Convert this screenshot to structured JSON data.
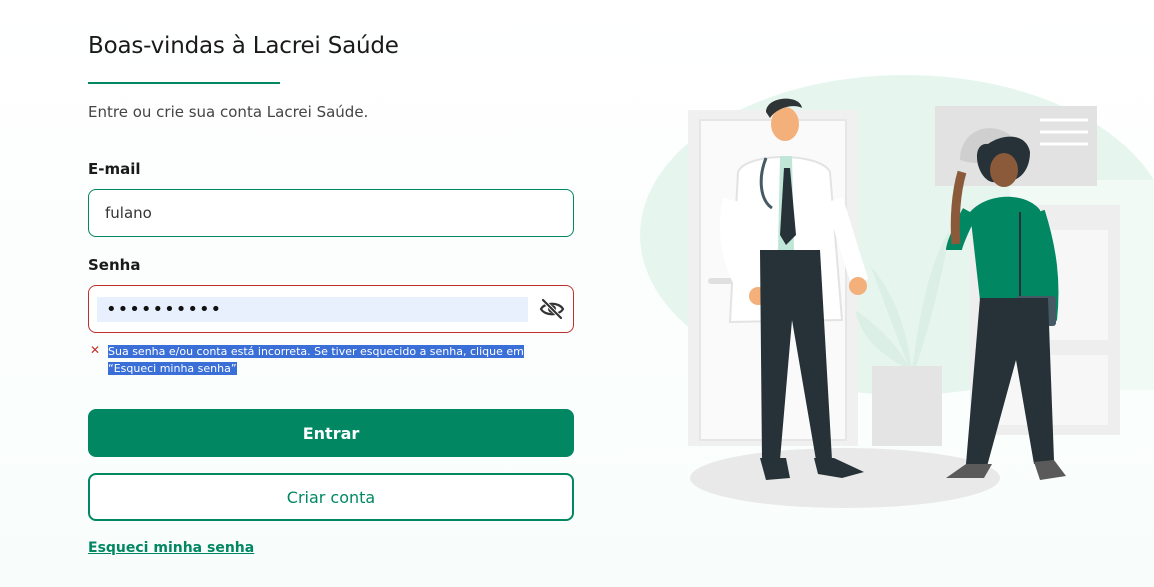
{
  "page": {
    "title": "Boas-vindas à Lacrei Saúde",
    "subtitle": "Entre ou crie sua conta Lacrei Saúde."
  },
  "form": {
    "email_label": "E-mail",
    "email_value": "fulano",
    "password_label": "Senha",
    "password_value": "••••••••••",
    "error_message": "Sua senha e/ou conta está incorreta. Se tiver esquecido a senha, clique em “Esqueci minha senha”",
    "error_icon": "close-x-icon"
  },
  "actions": {
    "login_label": "Entrar",
    "create_account_label": "Criar conta",
    "forgot_password_label": "Esqueci minha senha"
  },
  "icons": {
    "password_visibility": "eye-slash-icon"
  },
  "colors": {
    "brand_green": "#018762",
    "error_red": "#c0302b",
    "autofill_blue": "#e8f0fe",
    "selection_blue": "#3a6fd8"
  }
}
